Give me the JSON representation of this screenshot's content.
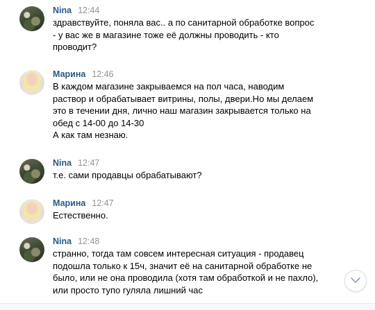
{
  "messages": [
    {
      "author": "Nina",
      "avatar": "nina",
      "time": "12:44",
      "lines": [
        "здравствуйте, поняла вас.. а по санитарной обработке вопрос",
        "- у вас же в магазине тоже её должны проводить - кто",
        "проводит?"
      ]
    },
    {
      "author": "Марина",
      "avatar": "marina",
      "time": "12:46",
      "lines": [
        "В каждом магазине закрываемся на пол часа, наводим",
        "раствор и обрабатывает витрины, полы, двери.Но мы делаем",
        "это в течении дня, лично наш магазин закрывается только на",
        "обед с 14-00 до 14-30",
        "А как там незнаю."
      ]
    },
    {
      "author": "Nina",
      "avatar": "nina",
      "time": "12:47",
      "lines": [
        "т.е. сами продавцы обрабатывают?"
      ]
    },
    {
      "author": "Марина",
      "avatar": "marina",
      "time": "12:47",
      "lines": [
        "Естественно."
      ]
    },
    {
      "author": "Nina",
      "avatar": "nina",
      "time": "12:48",
      "lines": [
        "странно, тогда там совсем интересная ситуация - продавец",
        "подошла только к 15ч, значит её на санитарной обработке не",
        "было, или не она проводила (хотя там обработкой и не пахло),",
        "или просто тупо гуляла лишний час"
      ]
    }
  ],
  "colors": {
    "author": "#2a5885",
    "time": "#939393",
    "text": "#000000"
  },
  "icons": {
    "scroll_down": "chevron-down-icon"
  }
}
